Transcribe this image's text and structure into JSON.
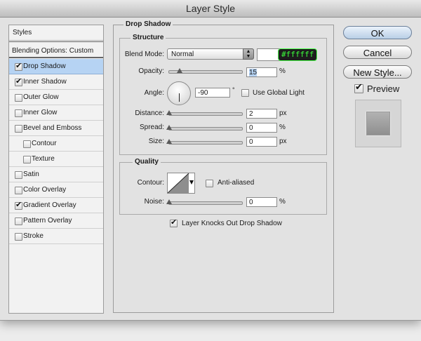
{
  "window": {
    "title": "Layer Style"
  },
  "sidebar": {
    "header": "Styles",
    "blending": "Blending Options: Custom",
    "items": [
      {
        "label": "Drop Shadow",
        "checked": true,
        "selected": true
      },
      {
        "label": "Inner Shadow",
        "checked": true
      },
      {
        "label": "Outer Glow",
        "checked": false
      },
      {
        "label": "Inner Glow",
        "checked": false
      },
      {
        "label": "Bevel and Emboss",
        "checked": false
      },
      {
        "label": "Contour",
        "checked": false,
        "sub": true
      },
      {
        "label": "Texture",
        "checked": false,
        "sub": true
      },
      {
        "label": "Satin",
        "checked": false
      },
      {
        "label": "Color Overlay",
        "checked": false
      },
      {
        "label": "Gradient Overlay",
        "checked": true
      },
      {
        "label": "Pattern Overlay",
        "checked": false
      },
      {
        "label": "Stroke",
        "checked": false
      }
    ]
  },
  "panel": {
    "title": "Drop Shadow",
    "structure": {
      "title": "Structure",
      "blend_mode_label": "Blend Mode:",
      "blend_mode_value": "Normal",
      "color_hex": "#ffffff",
      "opacity_label": "Opacity:",
      "opacity_value": "15",
      "opacity_percent": 15,
      "opacity_unit": "%",
      "angle_label": "Angle:",
      "angle_value": "-90",
      "angle_unit": "°",
      "global_light_label": "Use Global Light",
      "global_light_checked": false,
      "distance_label": "Distance:",
      "distance_value": "2",
      "distance_unit": "px",
      "spread_label": "Spread:",
      "spread_value": "0",
      "spread_unit": "%",
      "size_label": "Size:",
      "size_value": "0",
      "size_unit": "px"
    },
    "quality": {
      "title": "Quality",
      "contour_label": "Contour:",
      "antialiased_label": "Anti-aliased",
      "antialiased_checked": false,
      "noise_label": "Noise:",
      "noise_value": "0",
      "noise_unit": "%"
    },
    "knockout_label": "Layer Knocks Out Drop Shadow",
    "knockout_checked": true
  },
  "buttons": {
    "ok": "OK",
    "cancel": "Cancel",
    "new_style": "New Style...",
    "preview_label": "Preview",
    "preview_checked": true
  }
}
